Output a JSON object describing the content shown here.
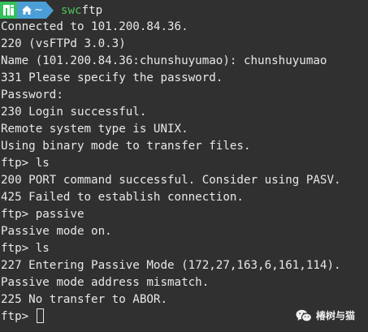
{
  "prompt": {
    "os_icon": "manjaro-logo-icon",
    "home_icon": "home-icon",
    "dir": "~",
    "command": "swc",
    "argument": "ftp"
  },
  "lines": [
    "Connected to 101.200.84.36.",
    "220 (vsFTPd 3.0.3)",
    "Name (101.200.84.36:chunshuyumao): chunshuyumao",
    "331 Please specify the password.",
    "Password:",
    "230 Login successful.",
    "Remote system type is UNIX.",
    "Using binary mode to transfer files.",
    "ftp> ls",
    "200 PORT command successful. Consider using PASV.",
    "425 Failed to establish connection.",
    "ftp> passive",
    "Passive mode on.",
    "ftp> ls",
    "227 Entering Passive Mode (172,27,163,6,161,114).",
    "Passive mode address mismatch.",
    "225 No transfer to ABOR."
  ],
  "current_prompt": "ftp> ",
  "watermark": {
    "icon": "wechat-icon",
    "text": "椿树与猫"
  },
  "colors": {
    "background": "#303030",
    "foreground": "#e8e8e8",
    "os_segment": "#35bf5c",
    "dir_segment": "#4b9fd6",
    "command": "#4fc35c"
  }
}
